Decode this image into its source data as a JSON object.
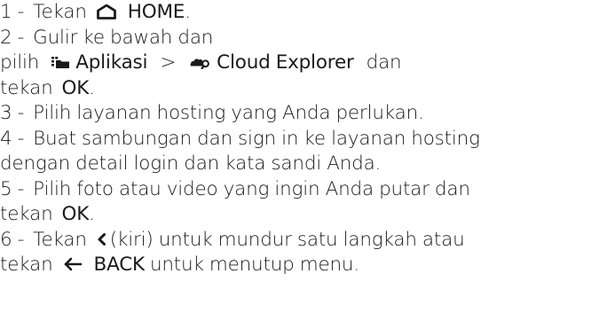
{
  "steps": {
    "s1": {
      "num": "1 -",
      "text_a": "Tekan",
      "home_label": "HOME",
      "end": "."
    },
    "s2": {
      "num": "2 -",
      "text_a": "Gulir ke bawah dan"
    },
    "s2b": {
      "text_a": "pilih",
      "apps_label": "Aplikasi",
      "sep": ">",
      "cloud_label": "Cloud Explorer",
      "text_b": "dan"
    },
    "s2c": {
      "text_a": "tekan",
      "ok_label": "OK",
      "end": "."
    },
    "s3": {
      "num": "3 -",
      "text_a": "Pilih layanan hosting yang Anda perlukan."
    },
    "s4": {
      "num": "4 -",
      "text_a": "Buat sambungan dan sign in ke layanan hosting"
    },
    "s4b": {
      "text_a": "dengan detail login dan kata sandi Anda."
    },
    "s5": {
      "num": "5 -",
      "text_a": "Pilih foto atau video yang ingin Anda putar dan"
    },
    "s5b": {
      "text_a": "tekan",
      "ok_label": "OK",
      "end": "."
    },
    "s6": {
      "num": "6 -",
      "text_a": "Tekan",
      "text_b": "(kiri) untuk mundur satu langkah atau"
    },
    "s6b": {
      "text_a": "tekan",
      "back_label": "BACK",
      "text_b": "untuk menutup menu."
    }
  },
  "icons": {
    "home": "home-icon",
    "apps": "apps-icon",
    "cloud": "cloud-explorer-icon",
    "left": "chevron-left-icon",
    "back": "back-arrow-icon"
  },
  "colors": {
    "text": "#1a1a1a",
    "background": "#ffffff"
  }
}
